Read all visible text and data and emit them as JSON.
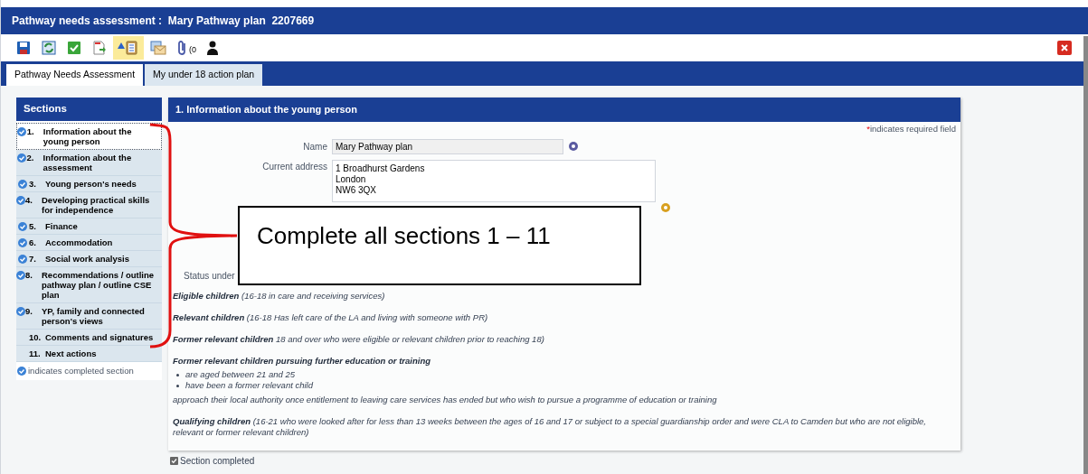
{
  "window": {
    "title": "Pathway needs assessment :  Mary Pathway plan  2207669"
  },
  "toolbar": [
    {
      "kind": "save",
      "selected": false
    },
    {
      "kind": "refresh",
      "selected": false
    },
    {
      "kind": "complete",
      "selected": false
    },
    {
      "kind": "export",
      "selected": false
    },
    {
      "kind": "warnings",
      "selected": true
    },
    {
      "kind": "mail",
      "selected": false
    },
    {
      "kind": "attach",
      "selected": false,
      "count": "(0"
    },
    {
      "kind": "person",
      "selected": false
    }
  ],
  "tabs": [
    {
      "label": "Pathway Needs Assessment",
      "selected": true
    },
    {
      "label": "My under 18 action plan",
      "selected": false
    }
  ],
  "sidebar": {
    "title": "Sections",
    "items": [
      {
        "number": "1.",
        "label": "Information about the young person",
        "completed": true,
        "selected": true
      },
      {
        "number": "2.",
        "label": "Information about the assessment",
        "completed": true,
        "selected": false
      },
      {
        "number": "3.",
        "label": "Young person's needs",
        "completed": true,
        "selected": false
      },
      {
        "number": "4.",
        "label": "Developing practical skills for independence",
        "completed": true,
        "selected": false
      },
      {
        "number": "5.",
        "label": "Finance",
        "completed": true,
        "selected": false
      },
      {
        "number": "6.",
        "label": "Accommodation",
        "completed": true,
        "selected": false
      },
      {
        "number": "7.",
        "label": "Social work analysis",
        "completed": true,
        "selected": false
      },
      {
        "number": "8.",
        "label": "Recommendations / outline pathway plan / outline CSE plan",
        "completed": true,
        "selected": false
      },
      {
        "number": "9.",
        "label": "YP, family and connected person's views",
        "completed": true,
        "selected": false
      },
      {
        "number": "10.",
        "label": "Comments and signatures",
        "completed": false,
        "selected": false
      },
      {
        "number": "11.",
        "label": "Next actions",
        "completed": false,
        "selected": false
      }
    ],
    "legend": "indicates completed section"
  },
  "form": {
    "header": "1. Information about the young person",
    "required_mark": "*",
    "required_note": "indicates required field",
    "name": {
      "label": "Name",
      "value": "Mary Pathway plan"
    },
    "address": {
      "label": "Current address",
      "value": "1 Broadhurst Gardens\nLondon\nNW6 3QX"
    },
    "status_label": "Status under",
    "notes": [
      {
        "kind": "definition",
        "term": "Eligible children",
        "text": "(16-18 in care and receiving services)"
      },
      {
        "kind": "definition",
        "term": "Relevant children",
        "text": "(16-18 Has left care of the LA and living with someone with PR)"
      },
      {
        "kind": "definition",
        "term": "Former relevant children",
        "text": "18 and over who were eligible or relevant children prior to reaching 18)"
      },
      {
        "kind": "list",
        "term": "Former relevant children pursuing further education or training",
        "bullets": [
          "are aged between 21 and 25",
          "have been a former relevant child"
        ],
        "text": "approach their local authority once entitlement to leaving care services has ended but who wish to pursue a programme of education or training"
      },
      {
        "kind": "definition",
        "term": "Qualifying children",
        "text": "(16-21 who were looked after for less than 13 weeks between the ages of 16 and 17 or subject to a special guardianship order and were CLA to Camden but who are not eligible, relevant or former relevant children)"
      }
    ]
  },
  "section_completed": {
    "label": "Section completed",
    "checked": true
  },
  "annotation": {
    "text": "Complete all sections 1 – 11"
  }
}
